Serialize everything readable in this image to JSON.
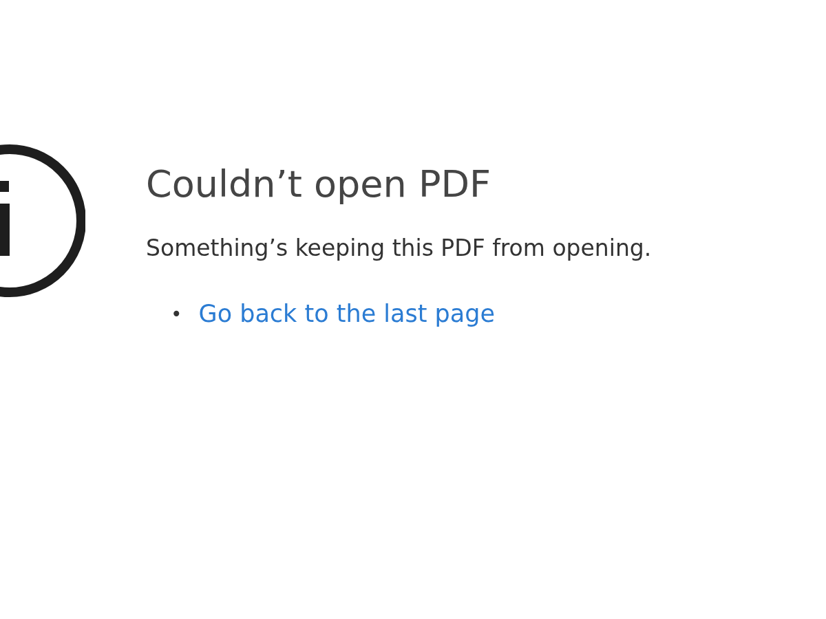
{
  "message": {
    "title": "Couldn’t open PDF",
    "description": "Something’s keeping this PDF from opening."
  },
  "actions": [
    {
      "bullet": "•",
      "text": "Go back to the last page"
    }
  ]
}
